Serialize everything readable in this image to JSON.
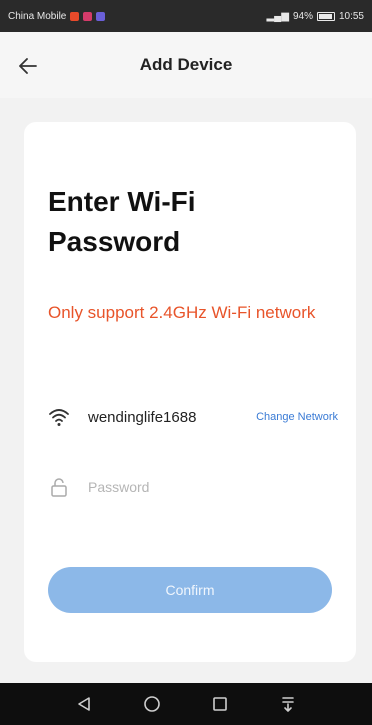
{
  "status_bar": {
    "carrier": "China Mobile",
    "signal_text": "94%",
    "time": "10:55"
  },
  "app_bar": {
    "title": "Add Device",
    "back_icon": "arrow-left-icon"
  },
  "card": {
    "heading": "Enter Wi-Fi Password",
    "notice": "Only support 2.4GHz Wi-Fi network",
    "wifi": {
      "icon": "wifi-icon",
      "ssid": "wendinglife1688",
      "change_label": "Change Network"
    },
    "password": {
      "icon": "lock-icon",
      "placeholder": "Password",
      "value": ""
    },
    "confirm_label": "Confirm"
  },
  "nav": {
    "back": "triangle-back-icon",
    "home": "circle-home-icon",
    "recents": "square-recents-icon",
    "notifications": "pull-down-icon"
  },
  "colors": {
    "accent": "#3a7bd5",
    "notice": "#e8542a",
    "button_disabled": "#8cb8e8"
  }
}
